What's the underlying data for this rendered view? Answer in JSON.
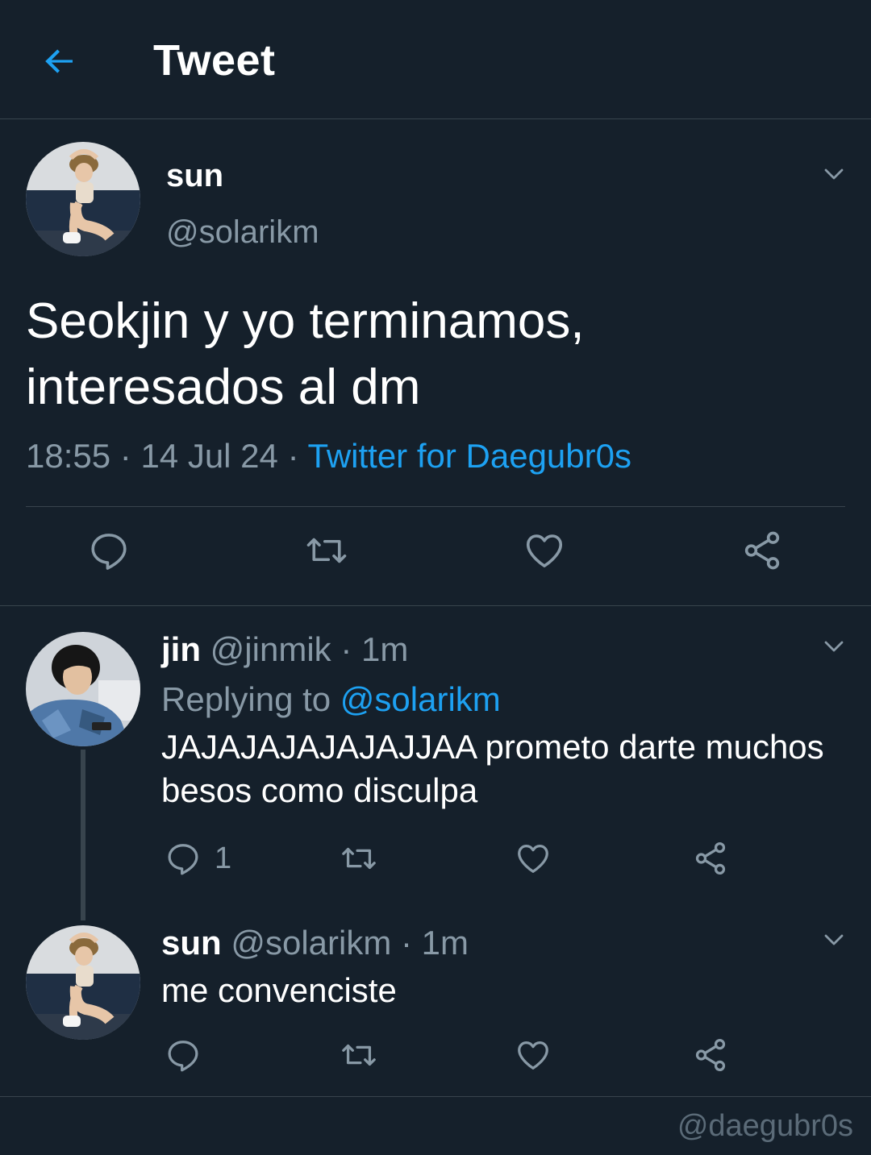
{
  "header": {
    "title": "Tweet",
    "back_icon": "arrow-left-icon",
    "accent": "#1da1f2"
  },
  "main_tweet": {
    "name": "sun",
    "handle": "@solarikm",
    "text": "Seokjin y yo terminamos, interesados al dm",
    "time": "18:55",
    "sep1": " · ",
    "date": "14 Jul 24",
    "sep2": " · ",
    "source": "Twitter for Daegubr0s",
    "actions": [
      "reply-icon",
      "retweet-icon",
      "like-icon",
      "share-icon"
    ]
  },
  "replies": [
    {
      "name": "jin",
      "handle": "@jinmik",
      "sep": " · ",
      "time": "1m",
      "replying_prefix": "Replying to ",
      "replying_handle": "@solarikm",
      "text": "JAJAJAJAJAJAJJAA prometo darte muchos besos como disculpa",
      "reply_count": "1"
    },
    {
      "name": "sun",
      "handle": "@solarikm",
      "sep": " · ",
      "time": "1m",
      "text": "me convenciste"
    }
  ],
  "watermark": "@daegubr0s",
  "colors": {
    "background": "#15202b",
    "border": "#38444d",
    "secondary_text": "#8899a6",
    "link": "#1da1f2"
  }
}
